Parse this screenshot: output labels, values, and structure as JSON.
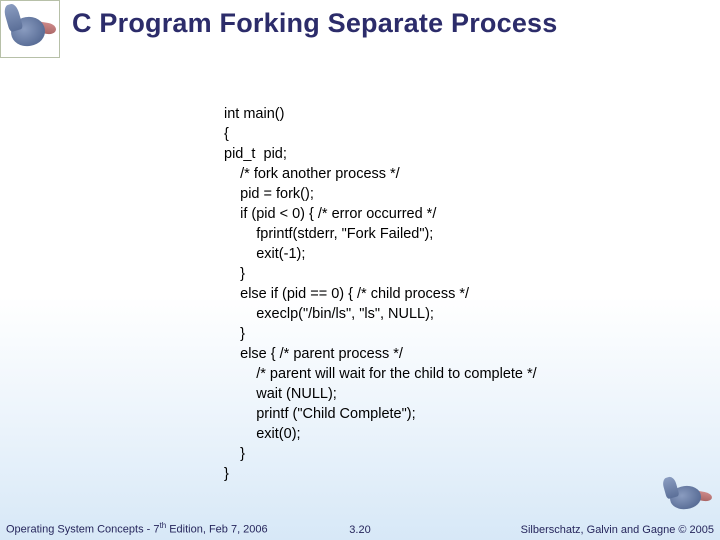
{
  "title": "C Program Forking Separate Process",
  "code": "int main()\n{\npid_t  pid;\n\t/* fork another process */\n\tpid = fork();\n\tif (pid < 0) { /* error occurred */\n\t\tfprintf(stderr, \"Fork Failed\");\n\t\texit(-1);\n\t}\n\telse if (pid == 0) { /* child process */\n\t\texeclp(\"/bin/ls\", \"ls\", NULL);\n\t}\n\telse { /* parent process */\n\t\t/* parent will wait for the child to complete */\n\t\twait (NULL);\n\t\tprintf (\"Child Complete\");\n\t\texit(0);\n\t}\n}",
  "footer": {
    "left_prefix": "Operating System Concepts - 7",
    "left_sup": "th",
    "left_suffix": " Edition, Feb 7, 2006",
    "center": "3.20",
    "right": "Silberschatz, Galvin and Gagne © 2005"
  }
}
